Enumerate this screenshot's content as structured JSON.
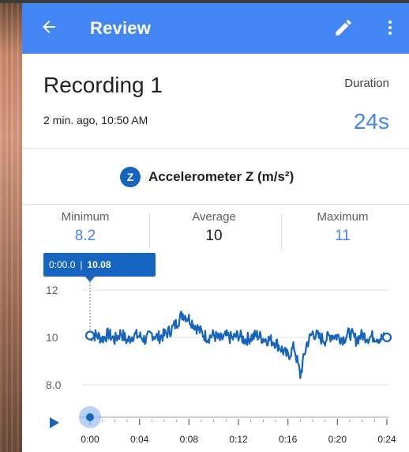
{
  "appbar": {
    "title": "Review",
    "back_icon": "arrow-back-icon",
    "edit_icon": "pencil-icon",
    "more_icon": "more-vert-icon",
    "color": "#4285f4"
  },
  "recording": {
    "title": "Recording 1",
    "subtitle": "2 min. ago, 10:50 AM",
    "duration_label": "Duration",
    "duration_value": "24s"
  },
  "sensor": {
    "icon_letter": "Z",
    "name": "Accelerometer Z (m/s²)"
  },
  "stats": {
    "minimum_label": "Minimum",
    "minimum_value": "8.2",
    "average_label": "Average",
    "average_value": "10",
    "maximum_label": "Maximum",
    "maximum_value": "11"
  },
  "tooltip": {
    "time": "0:00.0",
    "separator": "|",
    "value": "10.08"
  },
  "chart_data": {
    "type": "line",
    "x_unit": "seconds",
    "ylim": [
      7.7,
      12.3
    ],
    "y_ticks": [
      "12",
      "10",
      "8.0"
    ],
    "y_tick_values": [
      12,
      10,
      8.0
    ],
    "x_ticks": [
      "0:00",
      "0:04",
      "0:08",
      "0:12",
      "0:16",
      "0:20",
      "0:24"
    ],
    "xlim": [
      0,
      24
    ],
    "line_color": "#1565c0",
    "series": [
      {
        "x": [
          0,
          0.5,
          1,
          1.5,
          2,
          2.5,
          3,
          3.5,
          4,
          4.5,
          5,
          5.5,
          6,
          6.5,
          7,
          7.5,
          8,
          8.5,
          9,
          9.5,
          10,
          10.5,
          11,
          11.5,
          12,
          12.5,
          13,
          13.5,
          14,
          14.5,
          15,
          15.5,
          16,
          16.5,
          17,
          17.5,
          18,
          18.5,
          19,
          19.5,
          20,
          20.5,
          21,
          21.5,
          22,
          22.5,
          23,
          23.5,
          24
        ],
        "values": [
          10.08,
          10.1,
          9.95,
          10.15,
          9.9,
          10.2,
          9.85,
          10.1,
          10.05,
          9.9,
          10.15,
          10.0,
          10.1,
          10.3,
          10.6,
          11.0,
          10.8,
          10.5,
          10.2,
          10.0,
          10.1,
          9.9,
          10.05,
          9.95,
          10.1,
          9.9,
          10.0,
          10.1,
          9.95,
          9.9,
          9.8,
          9.5,
          9.2,
          9.6,
          8.4,
          9.7,
          10.2,
          10.0,
          9.9,
          10.1,
          10.05,
          9.95,
          10.2,
          9.9,
          10.1,
          10.0,
          10.05,
          9.95,
          10.0
        ]
      }
    ],
    "grid": true
  },
  "playback": {
    "play_icon": "play-icon",
    "position": 0
  }
}
